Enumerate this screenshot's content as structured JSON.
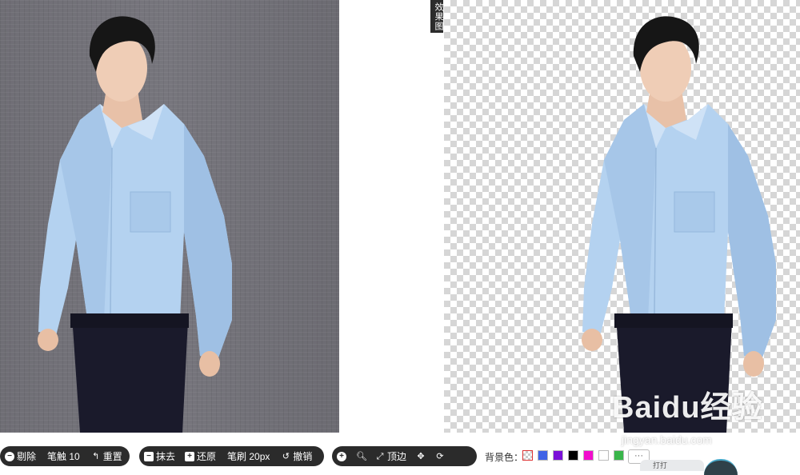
{
  "result_panel": {
    "tag": "效果图"
  },
  "toolbar": {
    "group1": {
      "erase_label": "剔除",
      "brush_label": "笔触 10",
      "reset_label": "重置"
    },
    "group2": {
      "wipe_label": "抹去",
      "restore_label": "还原",
      "brush_label": "笔刷 20px",
      "undo_label": "撤销"
    },
    "group3": {
      "fit_label": "顶边"
    },
    "background": {
      "label": "背景色：",
      "colors": [
        "transparent",
        "#3f63e6",
        "#7a10d8",
        "#000000",
        "#f20ccd",
        "#ffffff",
        "#39b54a"
      ],
      "more_label": "···"
    }
  },
  "watermark": {
    "brand": "Baidu经验",
    "url": "jingyan.baidu.com"
  },
  "floating": {
    "pill_text": "打打"
  }
}
